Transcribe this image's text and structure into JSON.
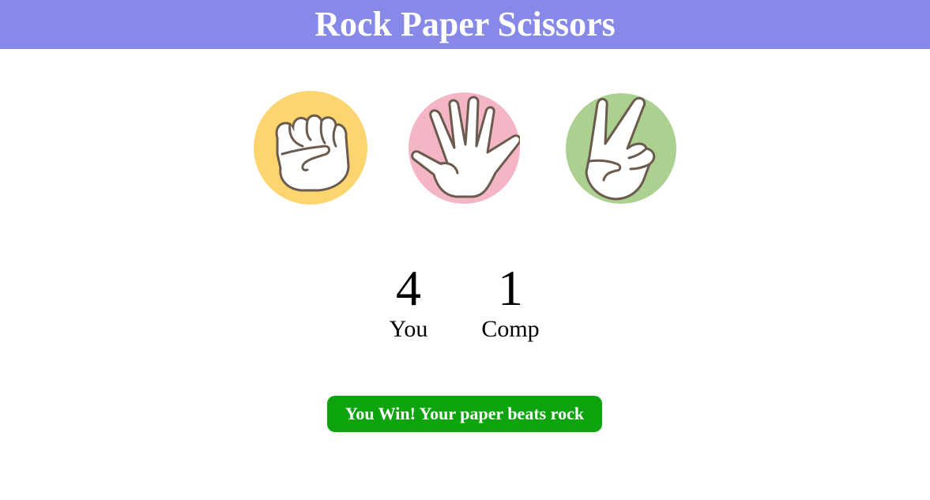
{
  "header": {
    "title": "Rock Paper Scissors"
  },
  "choices": [
    {
      "name": "rock",
      "color": "#fcd56e"
    },
    {
      "name": "paper",
      "color": "#f4b6c4"
    },
    {
      "name": "scissors",
      "color": "#abd08f"
    }
  ],
  "scores": {
    "user": {
      "value": "4",
      "label": "You"
    },
    "comp": {
      "value": "1",
      "label": "Comp"
    }
  },
  "result": {
    "message": "You Win! Your paper beats rock",
    "color": "#0ea40e"
  },
  "colors": {
    "header_bg": "#8789e8",
    "hand_fill": "#ffffff",
    "hand_stroke": "#6b5a4e"
  }
}
